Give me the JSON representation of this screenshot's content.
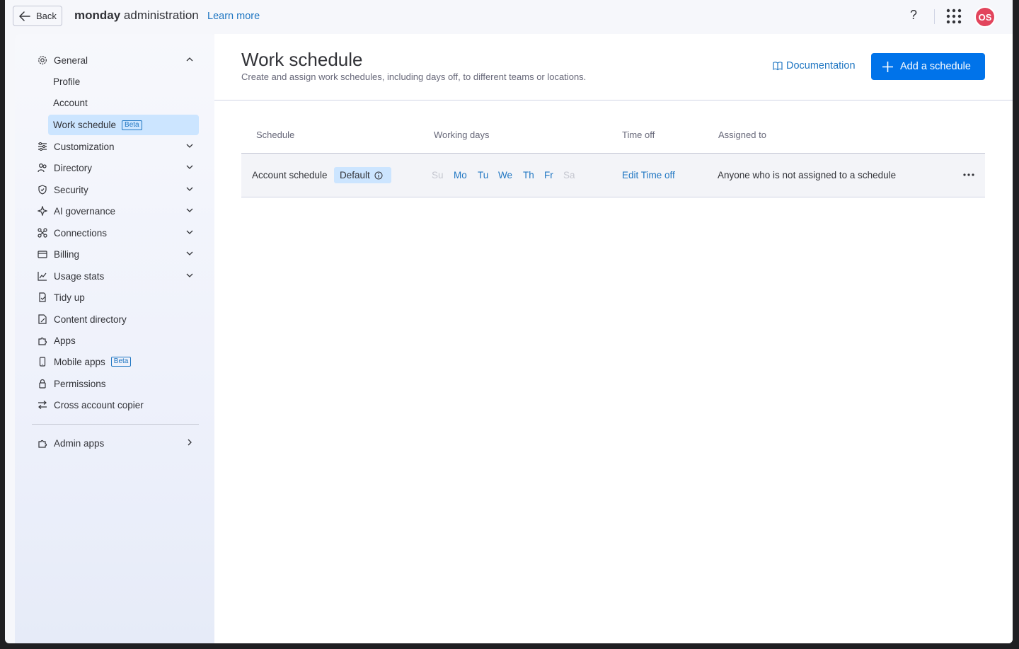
{
  "topbar": {
    "back_label": "Back",
    "brand_bold": "monday",
    "brand_rest": " administration",
    "learn_more": "Learn more",
    "help": "?",
    "avatar_initials": "OS"
  },
  "sidebar": {
    "items": [
      {
        "label": "General",
        "icon": "gear-icon",
        "chevron": "up"
      },
      {
        "label": "Profile"
      },
      {
        "label": "Account"
      },
      {
        "label": "Work schedule",
        "badge": "Beta",
        "active": true
      },
      {
        "label": "Customization",
        "icon": "sliders-icon",
        "chevron": "down"
      },
      {
        "label": "Directory",
        "icon": "people-icon",
        "chevron": "down"
      },
      {
        "label": "Security",
        "icon": "shield-icon",
        "chevron": "down"
      },
      {
        "label": "AI governance",
        "icon": "sparkle-icon",
        "chevron": "down"
      },
      {
        "label": "Connections",
        "icon": "connections-icon",
        "chevron": "down"
      },
      {
        "label": "Billing",
        "icon": "card-icon",
        "chevron": "down"
      },
      {
        "label": "Usage stats",
        "icon": "chart-icon",
        "chevron": "down"
      },
      {
        "label": "Tidy up",
        "icon": "broom-icon"
      },
      {
        "label": "Content directory",
        "icon": "doc-icon"
      },
      {
        "label": "Apps",
        "icon": "puzzle-icon"
      },
      {
        "label": "Mobile apps",
        "icon": "mobile-icon",
        "badge": "Beta"
      },
      {
        "label": "Permissions",
        "icon": "lock-icon"
      },
      {
        "label": "Cross account copier",
        "icon": "swap-icon"
      },
      {
        "label": "Admin apps",
        "icon": "puzzle-icon",
        "chevron": "right"
      }
    ]
  },
  "main": {
    "title": "Work schedule",
    "subtitle": "Create and assign work schedules, including days off, to different teams or locations.",
    "documentation": "Documentation",
    "add_button": "Add a schedule",
    "table": {
      "headers": [
        "Schedule",
        "Working days",
        "Time off",
        "Assigned to"
      ],
      "rows": [
        {
          "schedule": "Account schedule",
          "tag": "Default",
          "days": [
            "Su",
            "Mo",
            "Tu",
            "We",
            "Th",
            "Fr",
            "Sa"
          ],
          "days_active": [
            false,
            true,
            true,
            true,
            true,
            true,
            false
          ],
          "time_off": "Edit Time off",
          "assigned_to": "Anyone who is not assigned to a schedule"
        }
      ]
    }
  },
  "colors": {
    "primary": "#0073ea",
    "link": "#1f76c2",
    "active_bg": "#cce5ff",
    "avatar": "#e2445c"
  }
}
